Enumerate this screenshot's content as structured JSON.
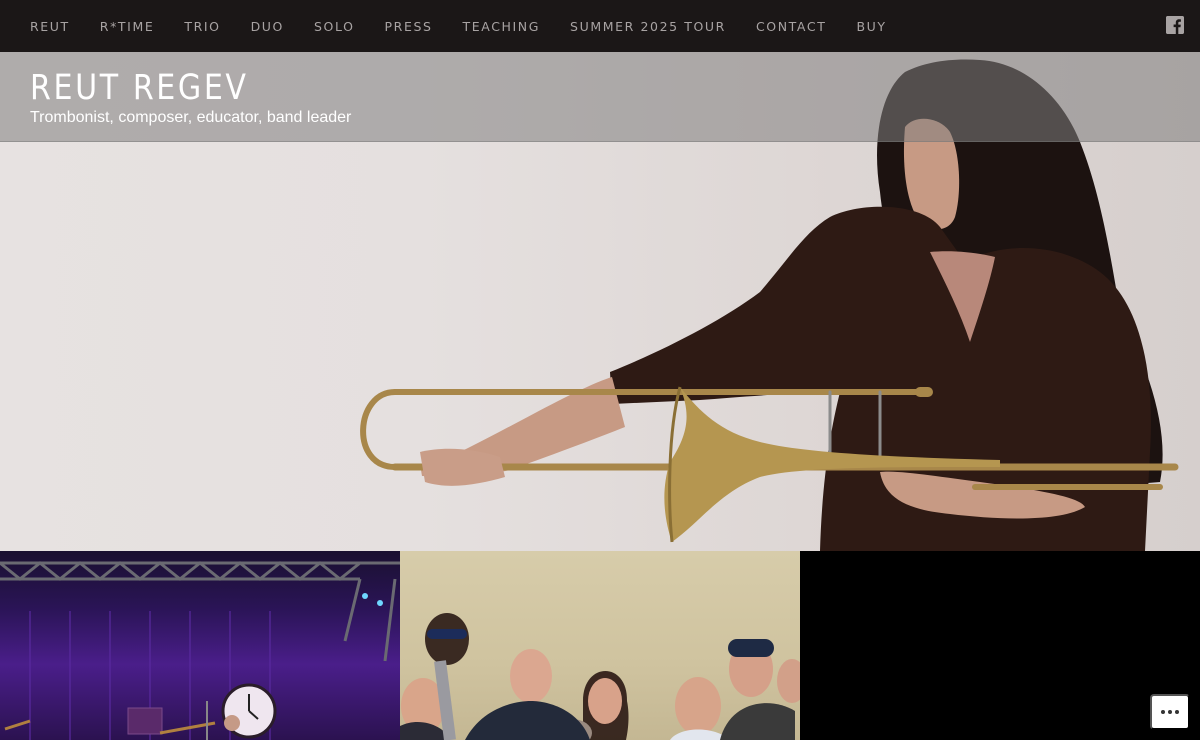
{
  "nav": {
    "items": [
      {
        "label": "REUT"
      },
      {
        "label": "R*TIME"
      },
      {
        "label": "TRIO"
      },
      {
        "label": "DUO"
      },
      {
        "label": "SOLO"
      },
      {
        "label": "PRESS"
      },
      {
        "label": "TEACHING"
      },
      {
        "label": "SUMMER 2025 TOUR"
      },
      {
        "label": "CONTACT"
      },
      {
        "label": "BUY"
      }
    ],
    "social_icon": "facebook-icon"
  },
  "header": {
    "title": "REUT REGEV",
    "tagline": "Trombonist, composer, educator, band leader"
  },
  "hero": {
    "image": "woman-holding-trombone-photo"
  },
  "tiles": [
    {
      "image": "concert-stage-photo"
    },
    {
      "image": "group-portrait-photo"
    },
    {
      "image": "black-tile"
    }
  ],
  "more_button_icon": "ellipsis-icon",
  "colors": {
    "nav_bg": "#1b1717",
    "nav_text": "#a8a3a3",
    "title_text": "#ffffff"
  }
}
